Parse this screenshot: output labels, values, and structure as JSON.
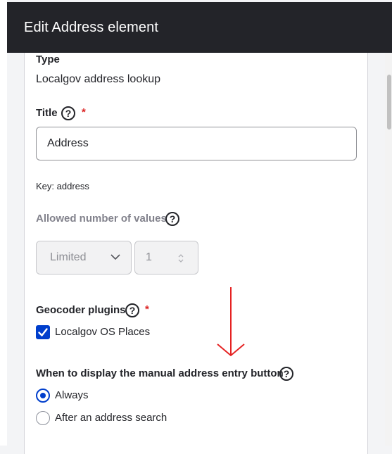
{
  "dialog": {
    "title": "Edit Address element"
  },
  "type_field": {
    "label": "Type",
    "value": "Localgov address lookup"
  },
  "title_field": {
    "label": "Title",
    "help": "?",
    "required_mark": "*",
    "value": "Address",
    "key_text": "Key: address"
  },
  "allowed_values": {
    "label": "Allowed number of values",
    "help": "?",
    "select_value": "Limited",
    "number_value": "1"
  },
  "geocoder": {
    "label": "Geocoder plugins",
    "help": "?",
    "required_mark": "*",
    "option_label": "Localgov OS Places",
    "checked": true
  },
  "manual_entry": {
    "label": "When to display the manual address entry button",
    "help": "?",
    "options": [
      {
        "label": "Always",
        "selected": true
      },
      {
        "label": "After an address search",
        "selected": false
      }
    ]
  },
  "colors": {
    "header_bg": "#232429",
    "accent": "#003ecc",
    "required": "#dc2323",
    "annotation": "#e52222"
  }
}
